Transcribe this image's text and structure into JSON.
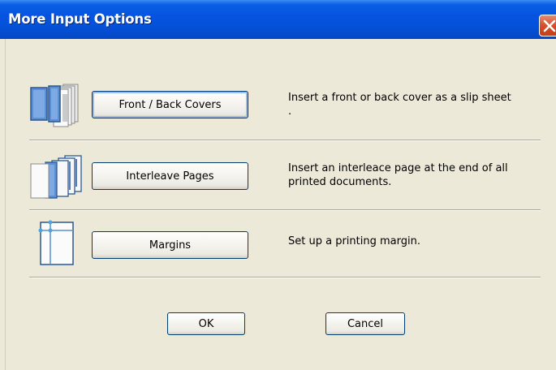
{
  "window": {
    "title": "More Input Options"
  },
  "options": [
    {
      "button_label": "Front / Back Covers",
      "description": "Insert a front or back cover as a slip sheet ."
    },
    {
      "button_label": "Interleave Pages",
      "description": "Insert an interleace page at the end of all printed documents."
    },
    {
      "button_label": "Margins",
      "description": "Set up a printing margin."
    }
  ],
  "footer": {
    "ok_label": "OK",
    "cancel_label": "Cancel"
  },
  "colors": {
    "titlebar": "#0451d8",
    "dialog_bg": "#ece9d8",
    "close_button": "#d84c2a",
    "button_border": "#003c74"
  },
  "icons": {
    "close": "close-icon",
    "covers": "front-back-covers-icon",
    "interleave": "interleave-pages-icon",
    "margins": "margins-icon"
  }
}
